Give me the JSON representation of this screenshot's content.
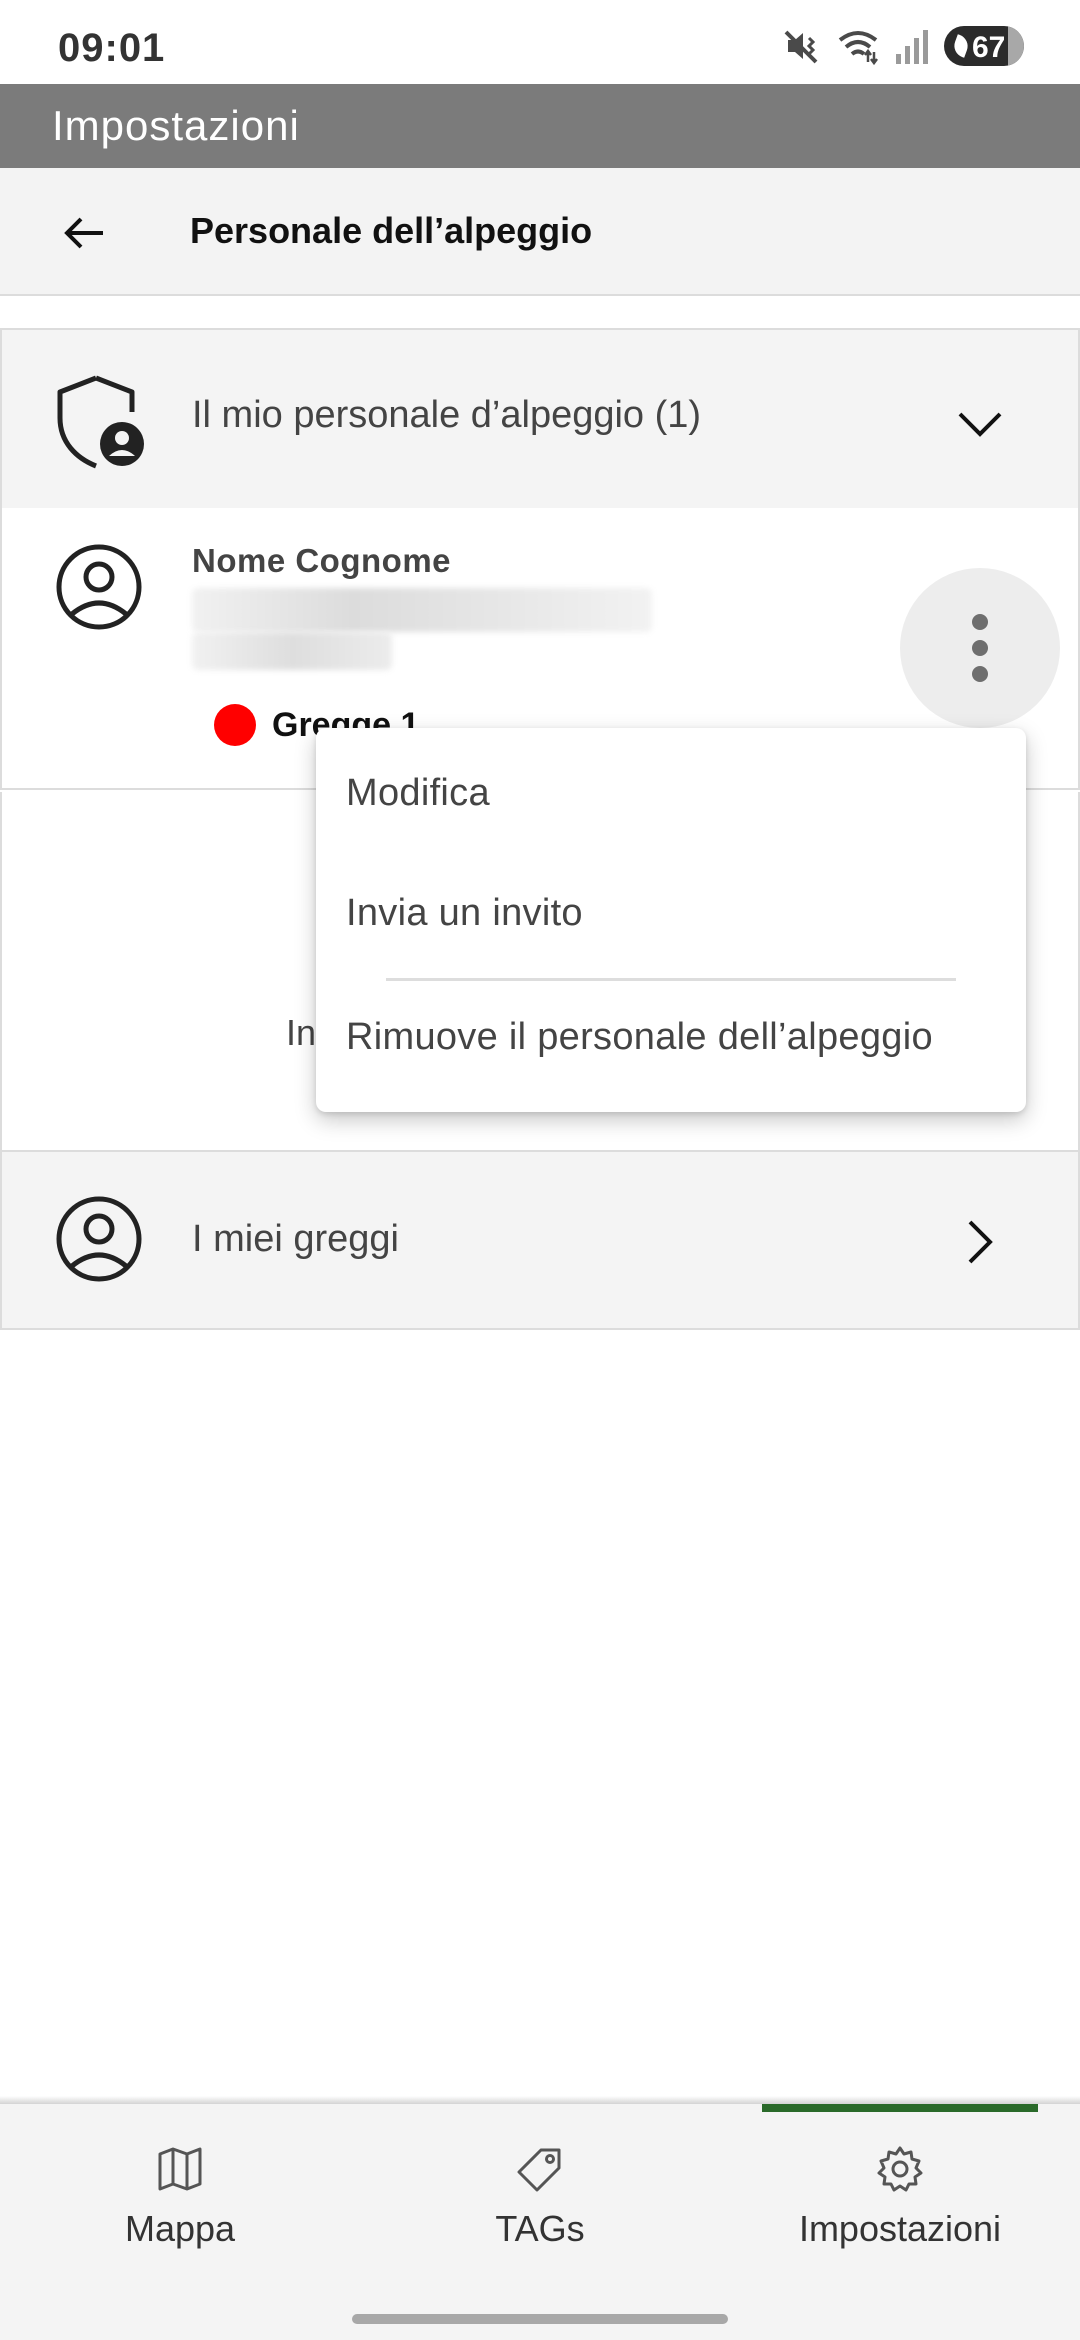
{
  "status_bar": {
    "time": "09:01",
    "battery": "67",
    "icons": [
      "mute-vibrate-icon",
      "wifi-icon",
      "signal-icon",
      "battery-icon"
    ]
  },
  "app_bar": {
    "title": "Impostazioni"
  },
  "header": {
    "title": "Personale dell’alpeggio",
    "back_icon": "arrow-left-icon"
  },
  "staff_section": {
    "title": "Il mio personale d’alpeggio (1)",
    "icon": "shield-user-icon",
    "toggle_icon": "chevron-down-icon"
  },
  "staff_member": {
    "name": "Nome Cognome",
    "herd_label": "Gregge 1",
    "herd_color": "#ff0000",
    "more_icon": "more-vertical-icon"
  },
  "empty_hint": "In",
  "context_menu": {
    "items": [
      "Modifica",
      "Invia un invito",
      "Rimuove il personale dell’alpeggio"
    ]
  },
  "herds_row": {
    "label": "I miei greggi",
    "icon": "user-circle-icon",
    "arrow_icon": "chevron-right-icon"
  },
  "bottom_nav": {
    "items": [
      {
        "label": "Mappa",
        "icon": "map-icon"
      },
      {
        "label": "TAGs",
        "icon": "tag-icon"
      },
      {
        "label": "Impostazioni",
        "icon": "gear-icon"
      }
    ],
    "active": "Impostazioni",
    "active_color": "#2a6a2a"
  }
}
